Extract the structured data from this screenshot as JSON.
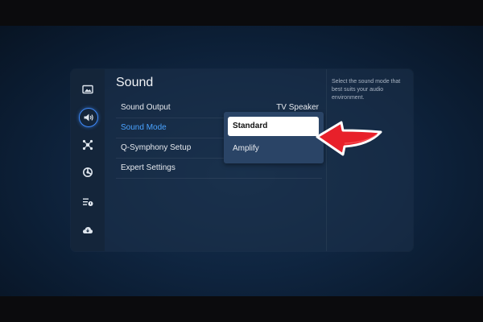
{
  "sidebar": {
    "items": [
      {
        "icon": "picture-icon"
      },
      {
        "icon": "sound-icon",
        "active": true
      },
      {
        "icon": "connection-icon"
      },
      {
        "icon": "general-icon"
      },
      {
        "icon": "support-list-icon"
      },
      {
        "icon": "cloud-icon"
      }
    ]
  },
  "page": {
    "title": "Sound"
  },
  "settings": {
    "rows": [
      {
        "label": "Sound Output",
        "value": "TV Speaker"
      },
      {
        "label": "Sound Mode",
        "value": ""
      },
      {
        "label": "Q-Symphony Setup",
        "value": ""
      },
      {
        "label": "Expert Settings",
        "value": ""
      }
    ]
  },
  "sound_mode_dropdown": {
    "options": [
      "Standard",
      "Amplify"
    ],
    "selected": "Standard"
  },
  "description": {
    "text": "Select the sound mode that best suits your audio environment."
  },
  "colors": {
    "accent": "#3f8cff",
    "active_label": "#4aa3ff",
    "annotation_arrow": "#e8202a"
  }
}
